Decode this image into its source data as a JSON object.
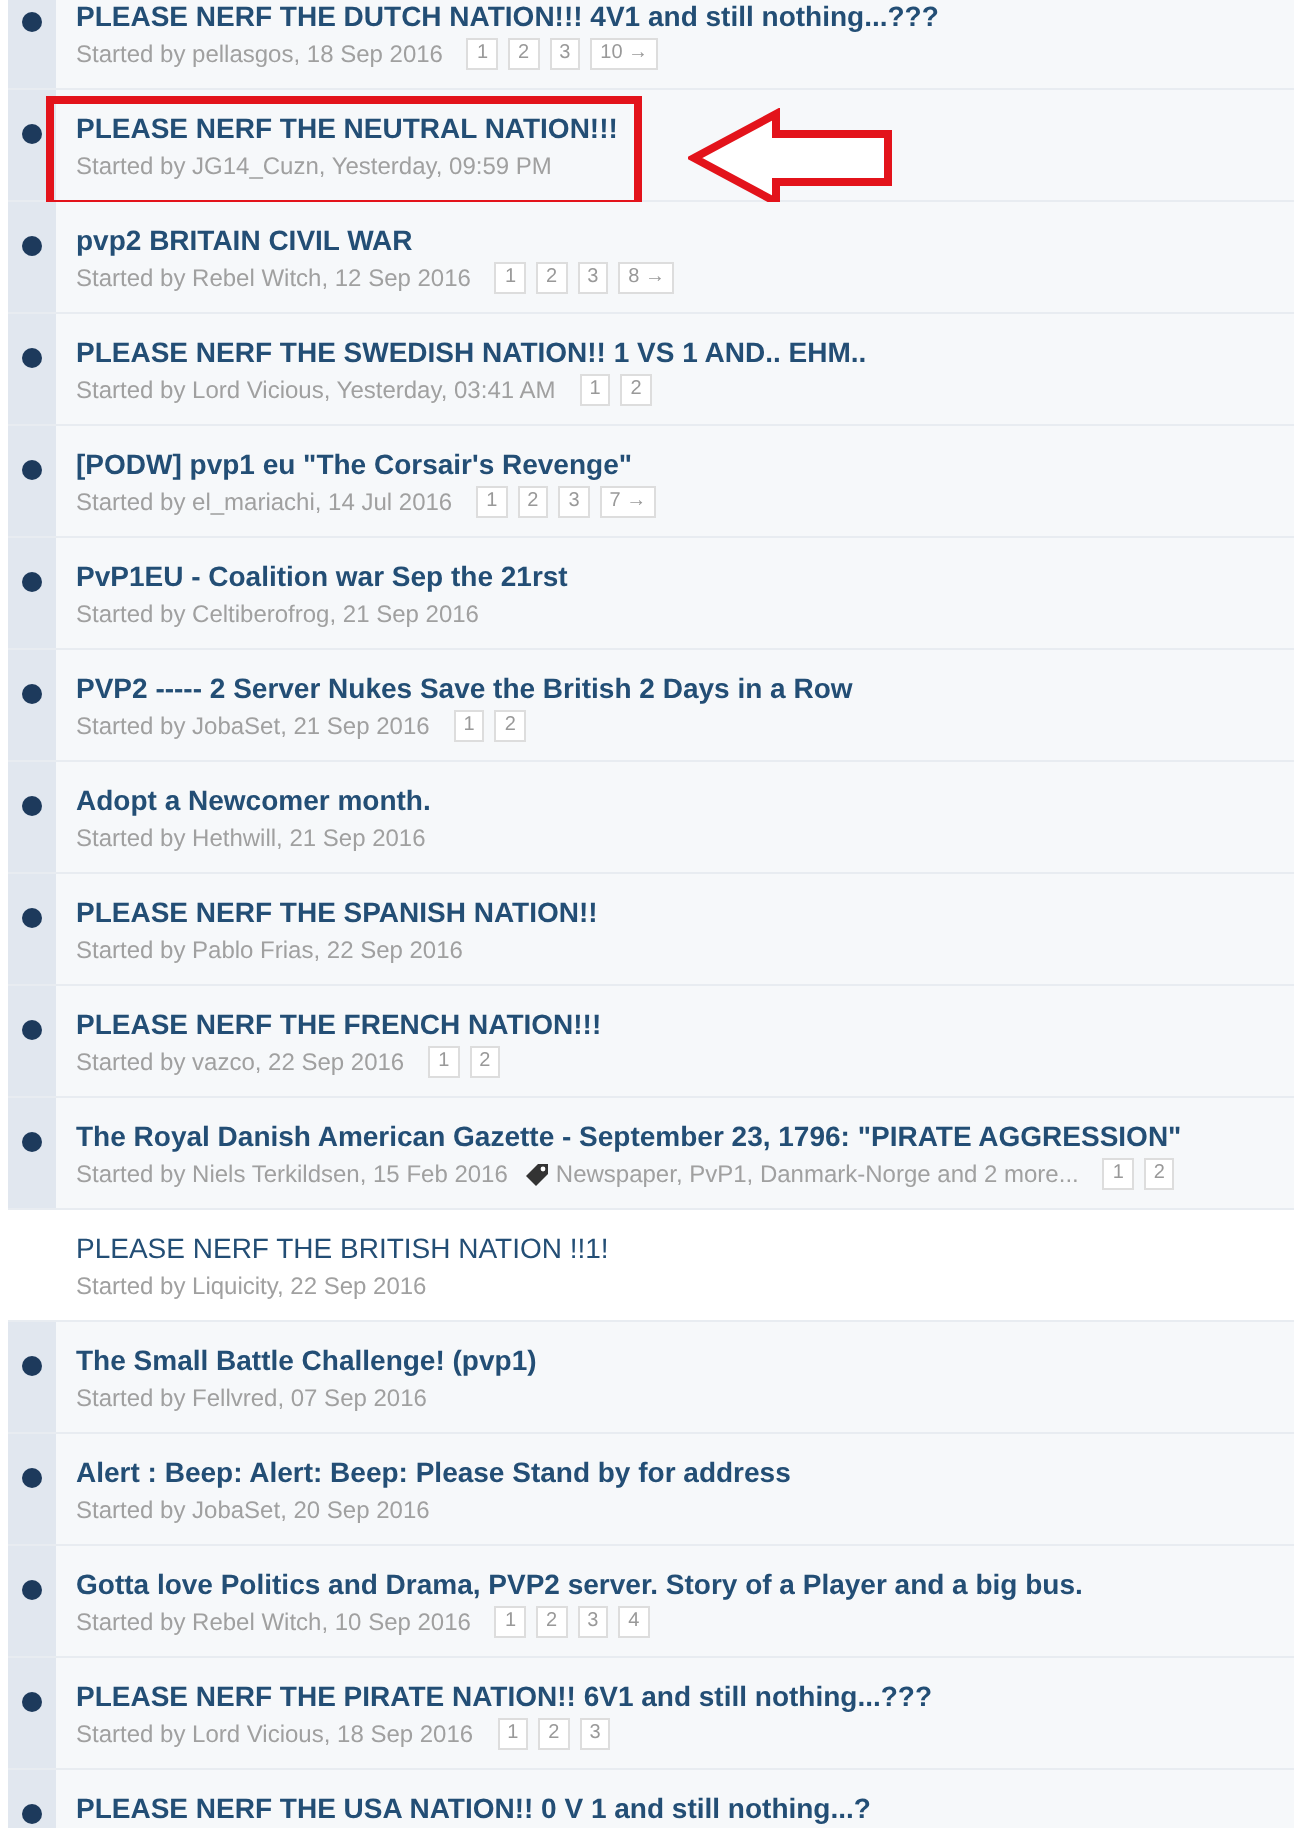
{
  "topics": [
    {
      "title": "PLEASE NERF THE DUTCH NATION!!! 4V1 and still nothing...???",
      "started_by": "Started by pellasgos, 18 Sep 2016",
      "pages": [
        "1",
        "2",
        "3",
        "10 →"
      ],
      "unread": true,
      "highlighted": false
    },
    {
      "title": "PLEASE NERF THE NEUTRAL NATION!!!",
      "started_by": "Started by JG14_Cuzn, Yesterday, 09:59 PM",
      "unread": true,
      "highlighted": true
    },
    {
      "title": "pvp2 BRITAIN CIVIL WAR",
      "started_by": "Started by Rebel Witch, 12 Sep 2016",
      "pages": [
        "1",
        "2",
        "3",
        "8 →"
      ],
      "unread": true,
      "highlighted": false
    },
    {
      "title": "PLEASE NERF THE SWEDISH NATION!! 1 VS 1 AND.. EHM..",
      "started_by": "Started by Lord Vicious, Yesterday, 03:41 AM",
      "pages": [
        "1",
        "2"
      ],
      "unread": true,
      "highlighted": false
    },
    {
      "title": "[PODW] pvp1 eu \"The Corsair's Revenge\"",
      "started_by": "Started by el_mariachi, 14 Jul 2016",
      "pages": [
        "1",
        "2",
        "3",
        "7 →"
      ],
      "unread": true,
      "highlighted": false
    },
    {
      "title": "PvP1EU - Coalition war Sep the 21rst",
      "started_by": "Started by Celtiberofrog, 21 Sep 2016",
      "unread": true,
      "highlighted": false
    },
    {
      "title": "PVP2 ----- 2 Server Nukes Save the British 2 Days in a Row",
      "started_by": "Started by JobaSet, 21 Sep 2016",
      "pages": [
        "1",
        "2"
      ],
      "unread": true,
      "highlighted": false
    },
    {
      "title": "Adopt a Newcomer month.",
      "started_by": "Started by Hethwill, 21 Sep 2016",
      "unread": true,
      "highlighted": false
    },
    {
      "title": "PLEASE NERF THE SPANISH NATION!!",
      "started_by": "Started by Pablo Frias, 22 Sep 2016",
      "unread": true,
      "highlighted": false
    },
    {
      "title": "PLEASE NERF THE FRENCH NATION!!!",
      "started_by": "Started by vazco, 22 Sep 2016",
      "pages": [
        "1",
        "2"
      ],
      "unread": true,
      "highlighted": false
    },
    {
      "title": "The Royal Danish American Gazette - September 23, 1796: \"PIRATE AGGRESSION\"",
      "started_by": "Started by Niels Terkildsen, 15 Feb 2016",
      "tags": "Newspaper, PvP1, Danmark-Norge and 2 more...",
      "pages": [
        "1",
        "2"
      ],
      "unread": true,
      "highlighted": false
    },
    {
      "title": "PLEASE NERF THE BRITISH NATION !!1!",
      "started_by": "Started by Liquicity, 22 Sep 2016",
      "unread": false,
      "highlighted": false
    },
    {
      "title": "The Small Battle Challenge! (pvp1)",
      "started_by": "Started by Fellvred, 07 Sep 2016",
      "unread": true,
      "highlighted": false
    },
    {
      "title": "Alert : Beep: Alert: Beep: Please Stand by for address",
      "started_by": "Started by JobaSet, 20 Sep 2016",
      "unread": true,
      "highlighted": false
    },
    {
      "title": "Gotta love Politics and Drama, PVP2 server. Story of a Player and a big bus.",
      "started_by": "Started by Rebel Witch, 10 Sep 2016",
      "pages": [
        "1",
        "2",
        "3",
        "4"
      ],
      "unread": true,
      "highlighted": false
    },
    {
      "title": "PLEASE NERF THE PIRATE NATION!! 6V1 and still nothing...???",
      "started_by": "Started by Lord Vicious, 18 Sep 2016",
      "pages": [
        "1",
        "2",
        "3"
      ],
      "unread": true,
      "highlighted": false
    },
    {
      "title": "PLEASE NERF THE USA NATION!! 0 V 1 and still nothing...?",
      "unread": true,
      "highlighted": false
    }
  ]
}
